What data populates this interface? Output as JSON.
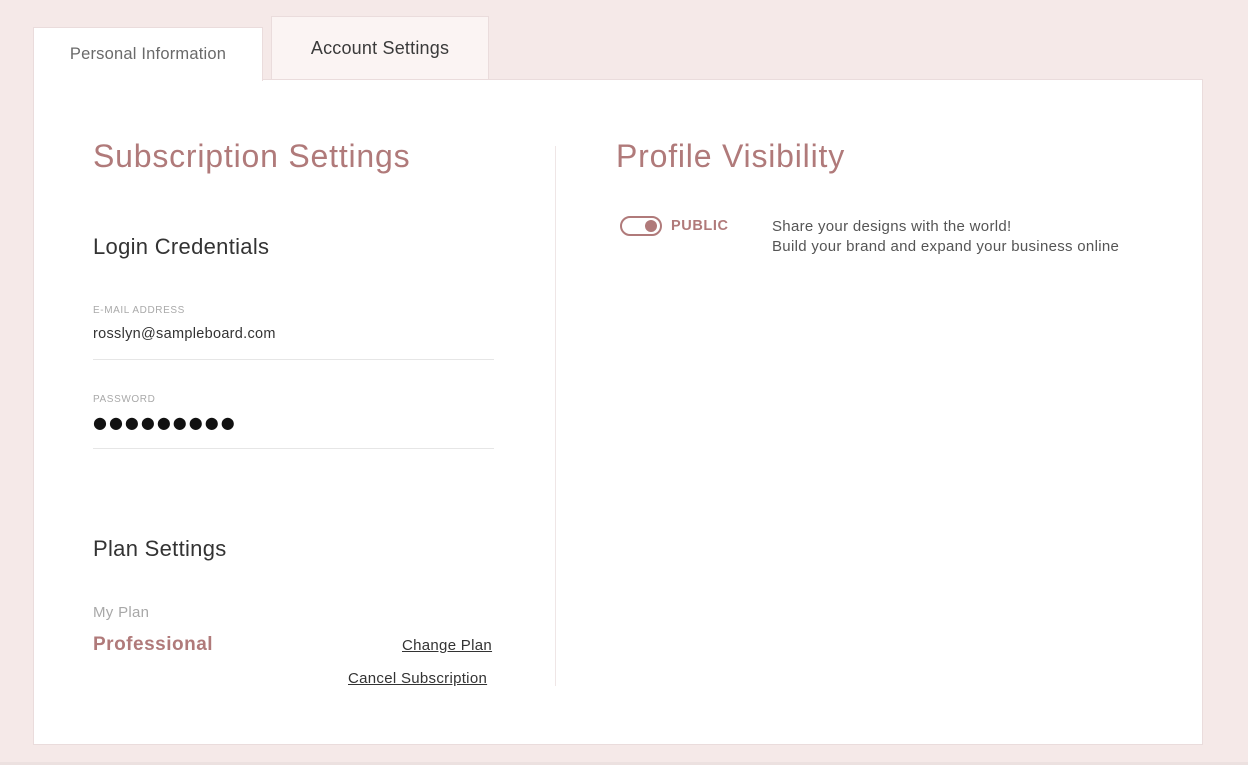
{
  "tabs": {
    "personal": "Personal Information",
    "account": "Account Settings"
  },
  "subscription": {
    "title": "Subscription Settings",
    "login": {
      "title": "Login Credentials",
      "email_label": "E-MAIL ADDRESS",
      "email_value": "rosslyn@sampleboard.com",
      "password_label": "PASSWORD",
      "password_value": "●●●●●●●●●"
    },
    "plan": {
      "title": "Plan Settings",
      "my_plan_label": "My Plan",
      "plan_name": "Professional",
      "change_plan": "Change Plan",
      "cancel_subscription": "Cancel Subscription"
    }
  },
  "visibility": {
    "title": "Profile Visibility",
    "toggle_label": "PUBLIC",
    "toggle_on": true,
    "desc_line1": "Share your designs with the world!",
    "desc_line2": "Build your brand and expand your business online"
  },
  "colors": {
    "background": "#f5e9e8",
    "accent": "#b07a7a",
    "panel": "#ffffff"
  }
}
